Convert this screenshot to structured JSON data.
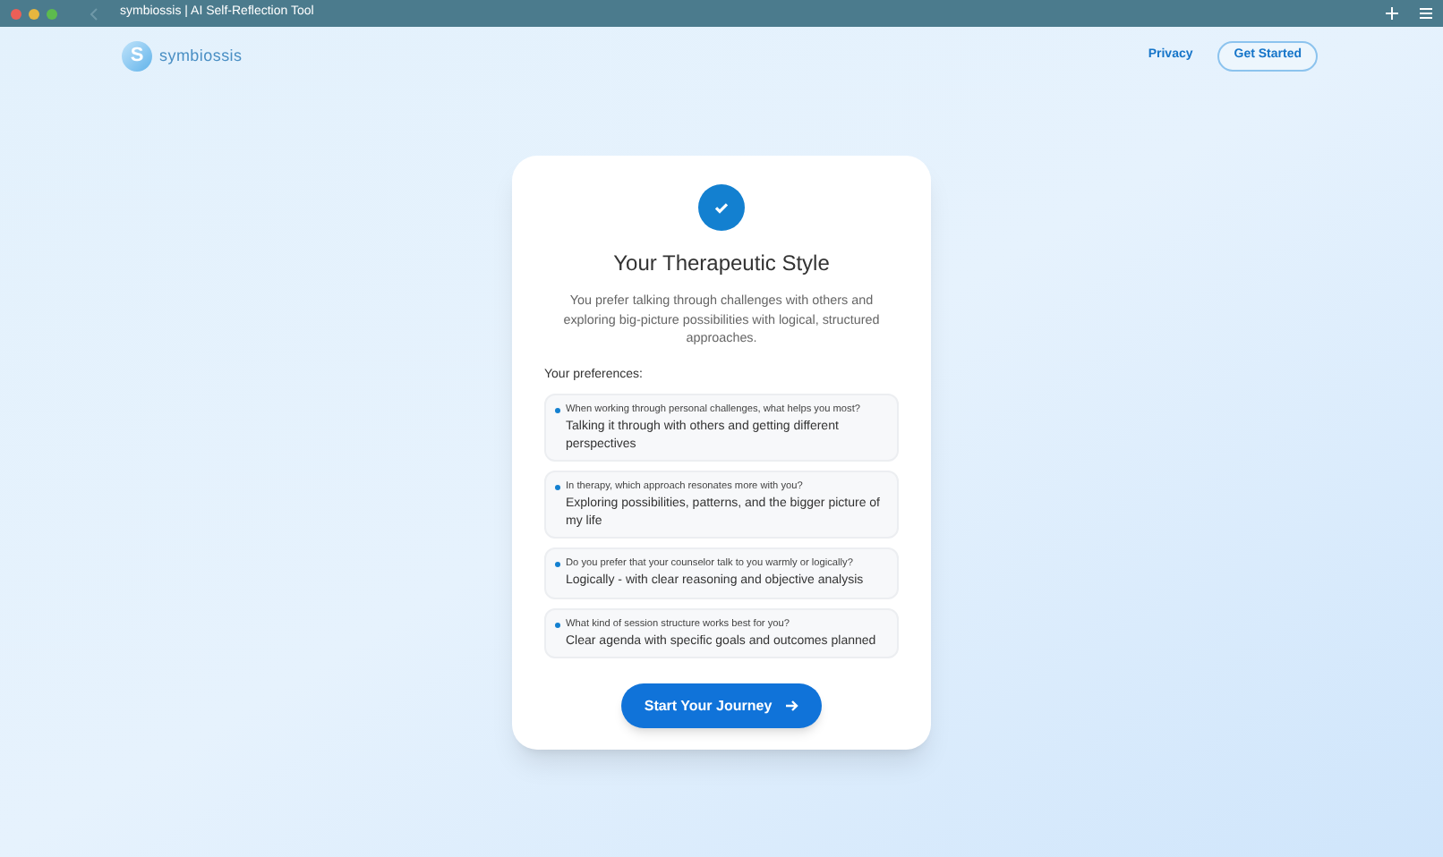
{
  "window": {
    "title": "symbiossis | AI Self-Reflection Tool"
  },
  "nav": {
    "logo_letter": "S",
    "brand": "symbiossis",
    "links": [
      "Privacy"
    ],
    "cta": "Get Started"
  },
  "card": {
    "title": "Your Therapeutic Style",
    "description": "You prefer talking through challenges with others and exploring big-picture possibilities with logical, structured approaches.",
    "preferences_label": "Your preferences:",
    "preferences": [
      {
        "question": "When working through personal challenges, what helps you most?",
        "answer": "Talking it through with others and getting different perspectives"
      },
      {
        "question": "In therapy, which approach resonates more with you?",
        "answer": "Exploring possibilities, patterns, and the bigger picture of my life"
      },
      {
        "question": "Do you prefer that your counselor talk to you warmly or logically?",
        "answer": "Logically - with clear reasoning and objective analysis"
      },
      {
        "question": "What kind of session structure works best for you?",
        "answer": "Clear agenda with specific goals and outcomes planned"
      }
    ],
    "button": "Start Your Journey"
  }
}
